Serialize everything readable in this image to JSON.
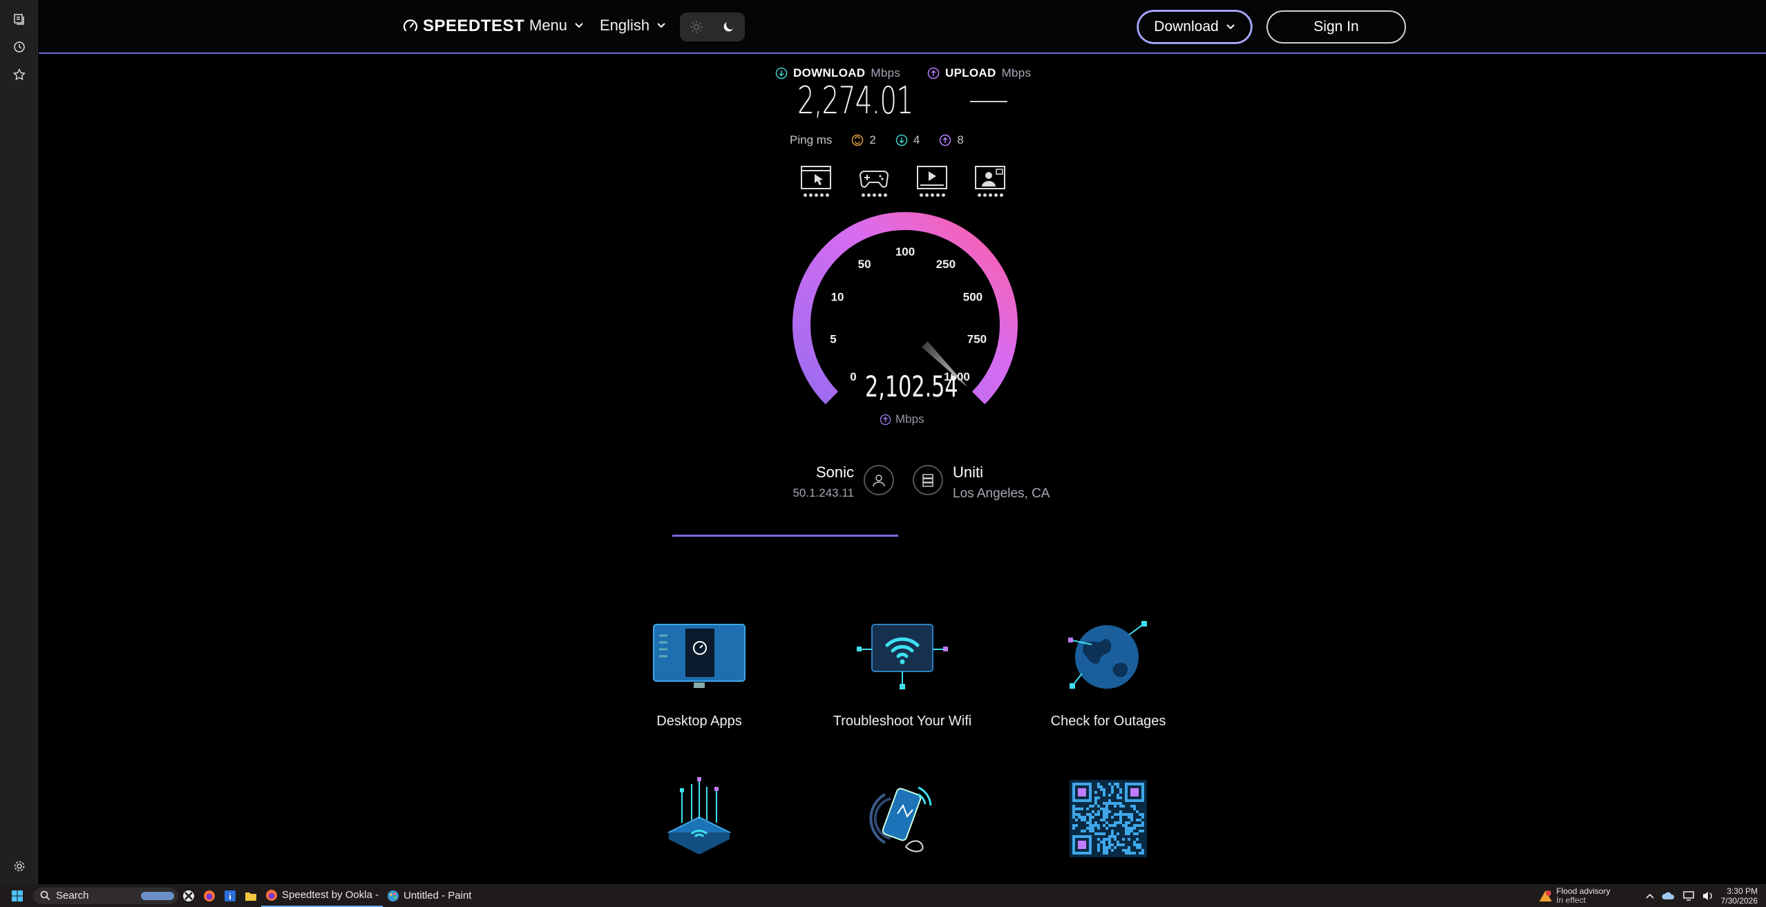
{
  "header": {
    "logo_text": "SPEEDTEST",
    "menu_label": "Menu",
    "language_label": "English",
    "download_label": "Download",
    "signin_label": "Sign In"
  },
  "results": {
    "download_label": "DOWNLOAD",
    "download_unit": "Mbps",
    "download_value": "2,274.01",
    "upload_label": "UPLOAD",
    "upload_unit": "Mbps",
    "ping_label": "Ping ms",
    "ping_idle": "2",
    "ping_download": "4",
    "ping_upload": "8"
  },
  "gauge": {
    "current_value": "2,102.54",
    "unit": "Mbps",
    "ticks": [
      "0",
      "5",
      "10",
      "50",
      "100",
      "250",
      "500",
      "750",
      "1000"
    ],
    "needle_at_tick": "1000",
    "colors": {
      "start": "#9b6cf0",
      "end": "#ff5fa2"
    }
  },
  "server": {
    "isp_name": "Sonic",
    "isp_ip": "50.1.243.11",
    "host_name": "Uniti",
    "host_location": "Los Angeles, CA"
  },
  "cards": [
    {
      "label": "Desktop Apps",
      "icon": "desktop-app-icon"
    },
    {
      "label": "Troubleshoot Your Wifi",
      "icon": "wifi-icon"
    },
    {
      "label": "Check for Outages",
      "icon": "globe-icon"
    },
    {
      "label": "",
      "icon": "router-icon"
    },
    {
      "label": "",
      "icon": "phone-signal-icon"
    },
    {
      "label": "",
      "icon": "qr-code-icon"
    }
  ],
  "taskbar": {
    "search_label": "Search",
    "app1_label": "Speedtest by Ookla - ",
    "app2_label": "Untitled - Paint",
    "alert_title": "Flood advisory",
    "alert_sub": "In effect",
    "time": "3:30 PM",
    "date": "7/30/2026"
  },
  "colors": {
    "accent": "#6b6bd8",
    "gauge_purple": "#9b6cf0",
    "gauge_pink": "#ff5fa2"
  }
}
